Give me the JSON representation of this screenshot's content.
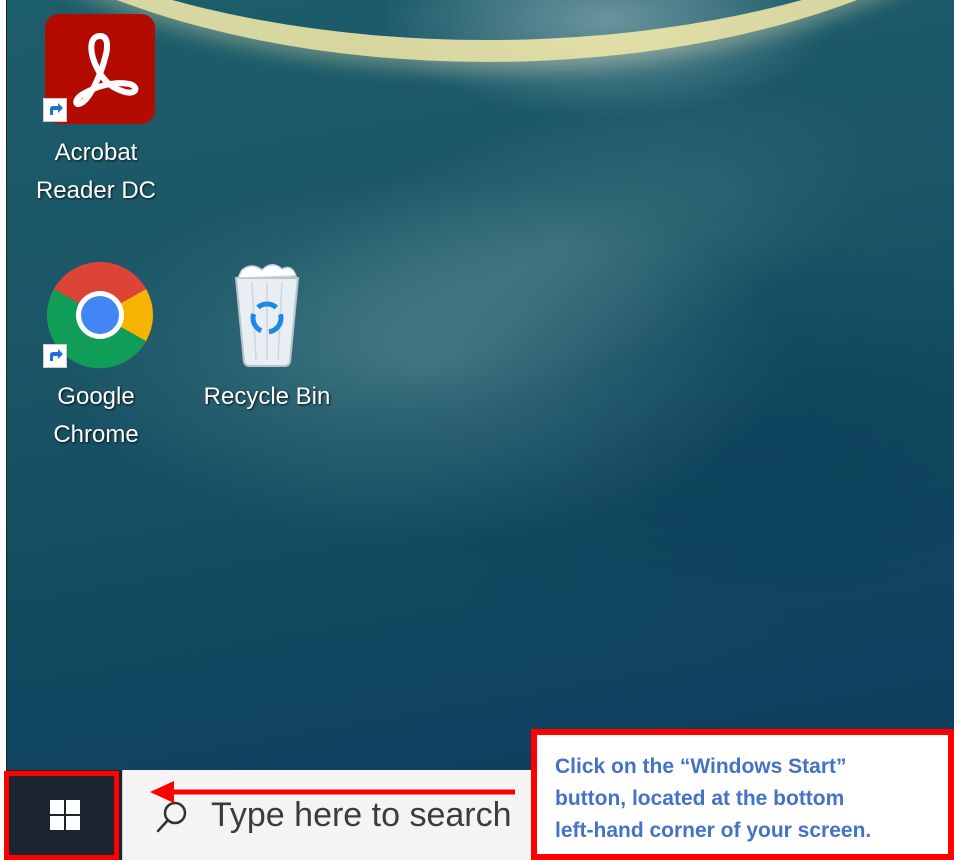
{
  "desktop": {
    "icons": [
      {
        "label_line1": "Acrobat",
        "label_line2": "Reader DC",
        "icon": "acrobat-reader-icon",
        "shortcut": true
      },
      {
        "label_line1": "Google",
        "label_line2": "Chrome",
        "icon": "google-chrome-icon",
        "shortcut": true
      },
      {
        "label_line1": "Recycle Bin",
        "icon": "recycle-bin-icon",
        "shortcut": false
      }
    ]
  },
  "taskbar": {
    "start_icon": "windows-logo-icon",
    "search_icon": "search-icon",
    "search_placeholder": "Type here to search"
  },
  "annotation": {
    "callout_line1": "Click on the “Windows Start”",
    "callout_line2": "button, located at the bottom",
    "callout_line3": "left-hand corner of your screen.",
    "highlight_color": "#ff0000",
    "text_color": "#4472c4"
  }
}
